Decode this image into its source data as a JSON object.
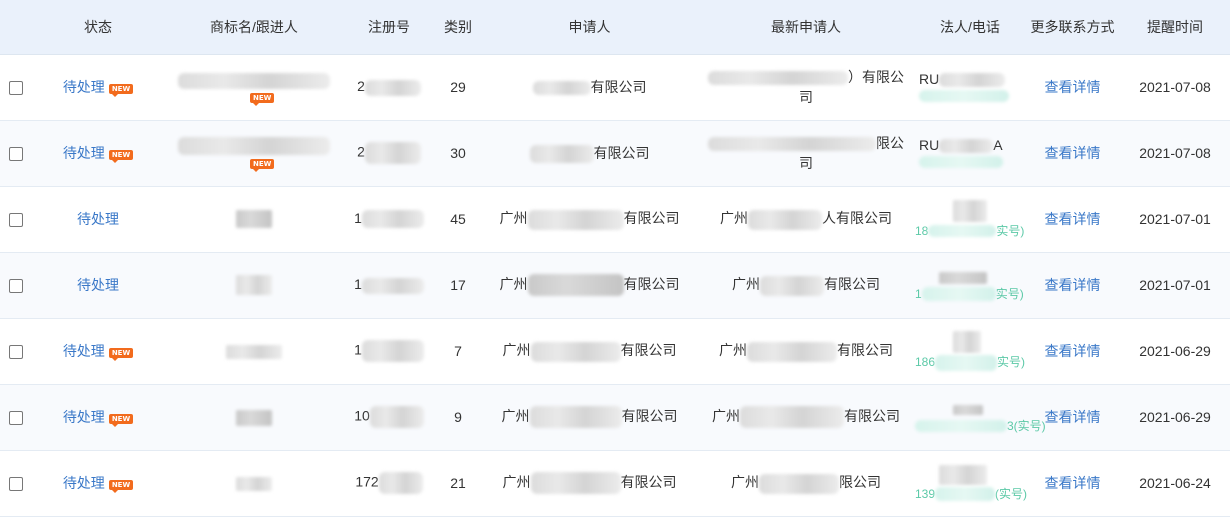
{
  "headers": {
    "status": "状态",
    "trademark": "商标名/跟进人",
    "reg_no": "注册号",
    "category": "类别",
    "applicant": "申请人",
    "latest_applicant": "最新申请人",
    "legal_phone": "法人/电话",
    "more_contact": "更多联系方式",
    "remind_time": "提醒时间"
  },
  "badge_text": "NEW",
  "rows": [
    {
      "status": "待处理",
      "new": true,
      "tm_new": true,
      "reg_prefix": "2",
      "category": "29",
      "applicant_tail": "有限公司",
      "latest_tail_1": "）有限公",
      "latest_tail_2": "司",
      "legal_prefix": "RU",
      "phone_text": "",
      "detail": "查看详情",
      "date": "2021-07-08"
    },
    {
      "status": "待处理",
      "new": true,
      "tm_new": true,
      "reg_prefix": "2",
      "category": "30",
      "applicant_tail": "有限公司",
      "latest_tail_1": "限公",
      "latest_tail_2": "司",
      "legal_prefix": "RU",
      "legal_suffix": "A",
      "phone_text": "",
      "detail": "查看详情",
      "date": "2021-07-08"
    },
    {
      "status": "待处理",
      "new": false,
      "tm_new": false,
      "reg_prefix": "1",
      "category": "45",
      "applicant_head": "广州",
      "applicant_tail": "有限公司",
      "latest_head": "广州",
      "latest_tail": "人有限公司",
      "phone_head": "18",
      "phone_tail": "实号)",
      "detail": "查看详情",
      "date": "2021-07-01"
    },
    {
      "status": "待处理",
      "new": false,
      "tm_new": false,
      "reg_prefix": "1",
      "category": "17",
      "applicant_head": "广州",
      "applicant_tail": "有限公司",
      "latest_head": "广州",
      "latest_tail": "有限公司",
      "phone_head": "1",
      "phone_tail": "实号)",
      "detail": "查看详情",
      "date": "2021-07-01"
    },
    {
      "status": "待处理",
      "new": true,
      "tm_new": false,
      "reg_prefix": "1",
      "category": "7",
      "applicant_head": "广州",
      "applicant_tail": "有限公司",
      "latest_head": "广州",
      "latest_tail": "有限公司",
      "phone_head": "186",
      "phone_tail": "实号)",
      "detail": "查看详情",
      "date": "2021-06-29"
    },
    {
      "status": "待处理",
      "new": true,
      "tm_new": false,
      "reg_prefix": "10",
      "category": "9",
      "applicant_head": "广州",
      "applicant_tail": "有限公司",
      "latest_head": "广州",
      "latest_tail": "有限公司",
      "phone_head": "",
      "phone_tail": "3(实号)",
      "detail": "查看详情",
      "date": "2021-06-29"
    },
    {
      "status": "待处理",
      "new": true,
      "tm_new": false,
      "reg_prefix": "172",
      "category": "21",
      "applicant_head": "广州",
      "applicant_tail": "有限公司",
      "latest_head": "广州",
      "latest_tail": "限公司",
      "phone_head": "139",
      "phone_tail": "(实号)",
      "detail": "查看详情",
      "date": "2021-06-24"
    }
  ]
}
